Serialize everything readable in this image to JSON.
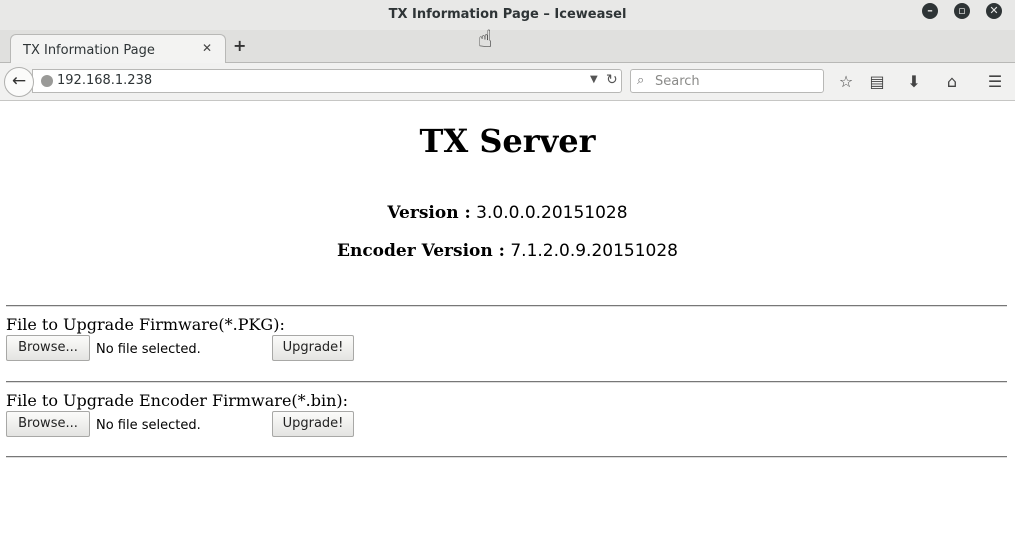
{
  "window": {
    "title": "TX Information Page – Iceweasel",
    "controls": {
      "minimize": "–",
      "maximize": "▫",
      "close": "✕"
    }
  },
  "tabs": [
    {
      "label": "TX Information Page",
      "close": "✕"
    }
  ],
  "new_tab": "+",
  "navbar": {
    "back": "←",
    "url": "192.168.1.238",
    "search_placeholder": "Search",
    "icons": [
      "globe-icon",
      "dropdown-icon",
      "reload-icon",
      "search-icon",
      "bookmark-star-icon",
      "reading-list-icon",
      "download-icon",
      "home-icon",
      "menu-icon"
    ]
  },
  "page": {
    "title": "TX Server",
    "version_label": "Version :",
    "version_value": "3.0.0.0.20151028",
    "encoder_label": "Encoder Version :",
    "encoder_value": "7.1.2.0.9.20151028",
    "sections": [
      {
        "label": "File to Upgrade Firmware(*.PKG):",
        "browse": "Browse...",
        "status": "No file selected.",
        "upgrade": "Upgrade!"
      },
      {
        "label": "File to Upgrade Encoder Firmware(*.bin):",
        "browse": "Browse...",
        "status": "No file selected.",
        "upgrade": "Upgrade!"
      }
    ]
  }
}
